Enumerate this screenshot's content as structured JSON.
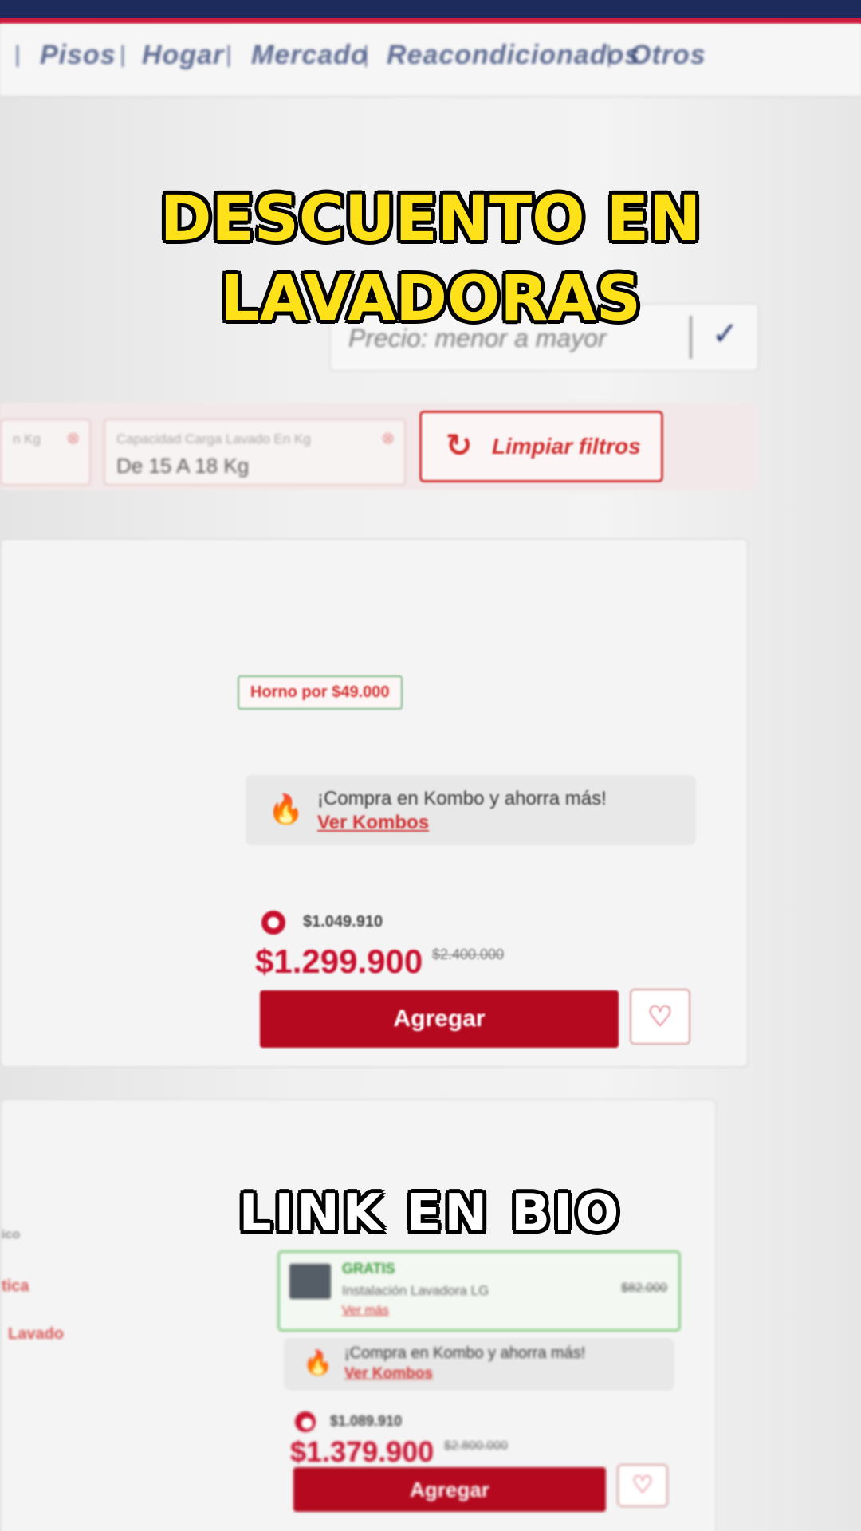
{
  "nav": {
    "items": [
      "Pisos",
      "Hogar",
      "Mercado",
      "Reacondicionados",
      "Otros"
    ],
    "separator": "|"
  },
  "overlay": {
    "headline_line1": "DESCUENTO EN",
    "headline_line2": "LAVADORAS",
    "footer": "LINK EN BIO"
  },
  "sort": {
    "value": "Precio: menor a mayor",
    "chevron_icon": "chevron-down-icon"
  },
  "filters": {
    "chip1": {
      "label": "n Kg",
      "value": ""
    },
    "chip2": {
      "label": "Capacidad Carga Lavado En Kg",
      "value": "De 15 A 18 Kg"
    },
    "remove_icon": "close-icon",
    "clear_label": "Limpiar filtros",
    "clear_icon": "refresh-icon"
  },
  "products": [
    {
      "badge": "Horno por $49.000",
      "kombo_title": "¡Compra en Kombo y ahorra más!",
      "kombo_link": "Ver Kombos",
      "points": "$1.049.910",
      "price": "$1.299.900",
      "old_price": "$2.400.000",
      "add_label": "Agregar",
      "fav_icon": "heart-icon"
    },
    {
      "gift_title": "GRATIS",
      "gift_desc": "Instalación Lavadora LG",
      "gift_link": "Ver más",
      "gift_price": "$82.000",
      "kombo_title": "¡Compra en Kombo y ahorra más!",
      "kombo_link": "Ver Kombos",
      "points": "$1.089.910",
      "price": "$1.379.900",
      "old_price": "$2.800.000",
      "add_label": "Agregar",
      "fav_icon": "heart-icon"
    }
  ],
  "side_labels": [
    "ico",
    "tica",
    "Lavado"
  ],
  "colors": {
    "brand_red": "#c8102e",
    "nav_blue": "#2d3f73",
    "caption_yellow": "#ffe11a"
  }
}
